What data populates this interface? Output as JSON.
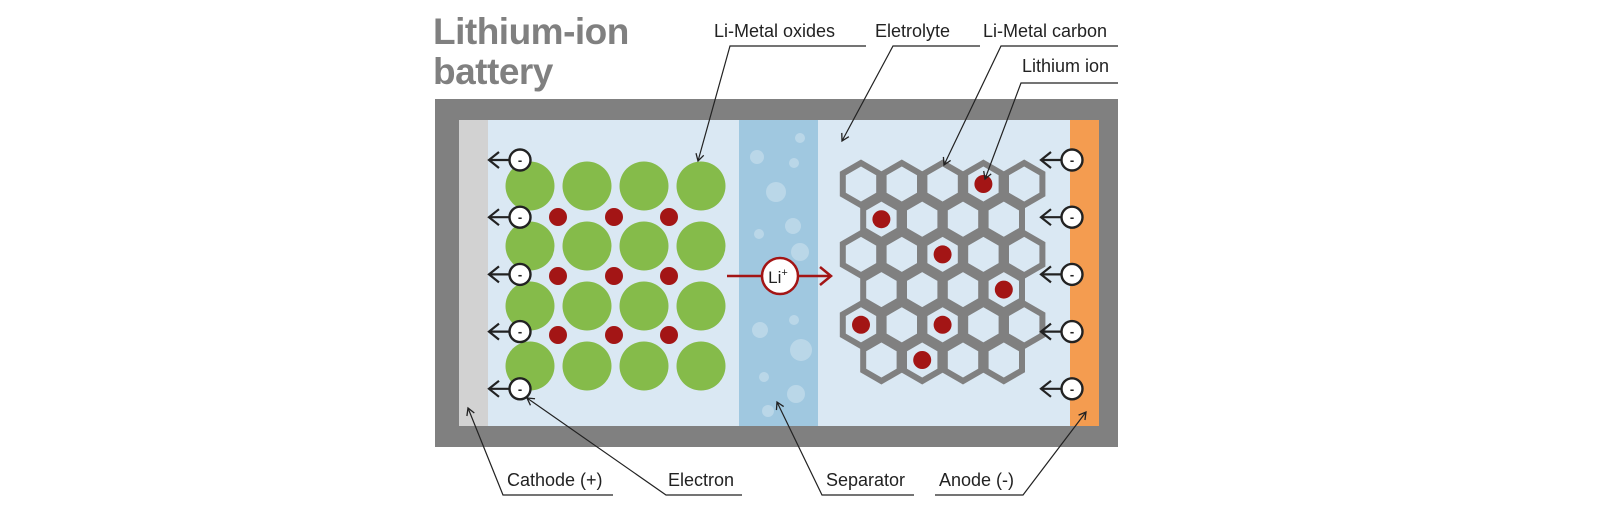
{
  "title": {
    "line1": "Lithium-ion",
    "line2": "battery"
  },
  "labels": {
    "li_metal_oxides": "Li-Metal oxides",
    "electrolyte": "Eletrolyte",
    "li_metal_carbon": "Li-Metal carbon",
    "lithium_ion": "Lithium ion",
    "cathode": "Cathode (+)",
    "electron": "Electron",
    "separator": "Separator",
    "anode": "Anode (-)"
  },
  "ion_badge": {
    "symbol": "Li",
    "charge": "+"
  },
  "electron_symbol": "-",
  "colors": {
    "casing": "#808080",
    "electrolyte_bg": "#dae8f3",
    "separator": "#a0c8e0",
    "cathode_plate": "#d2d2d2",
    "anode_plate": "#f49c50",
    "oxide_sphere": "#85bb4a",
    "lithium_ion": "#a31515",
    "carbon_lattice": "#808080",
    "ion_arrow": "#a31515",
    "text": "#222222",
    "title": "#808080"
  },
  "structure": {
    "oxide_grid": {
      "rows": 4,
      "cols": 4
    },
    "cathode_lithium_ions": {
      "rows": 3,
      "cols": 3
    },
    "carbon_lattice_rows": [
      5,
      4,
      5,
      4,
      5,
      4
    ],
    "anode_lithium_ion_cells": [
      [
        0,
        3
      ],
      [
        1,
        0
      ],
      [
        2,
        2
      ],
      [
        3,
        3
      ],
      [
        4,
        0
      ],
      [
        4,
        2
      ],
      [
        5,
        1
      ]
    ],
    "electrons_per_side": 5
  }
}
